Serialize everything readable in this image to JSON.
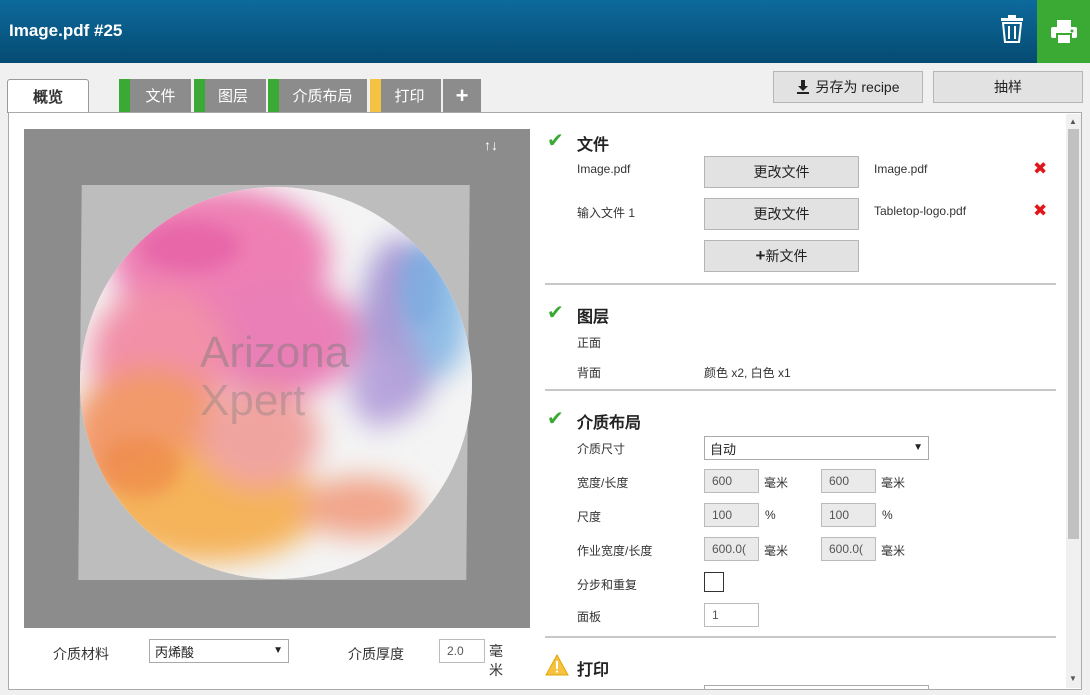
{
  "window": {
    "title": "Image.pdf #25"
  },
  "header": {
    "trash_icon": "trash-icon",
    "print_icon": "printer-icon",
    "print_color": "#3aaa35"
  },
  "tabs": [
    {
      "label": "概览",
      "active": true
    },
    {
      "label": "文件",
      "stripe": "#3aaa35"
    },
    {
      "label": "图层",
      "stripe": "#3aaa35"
    },
    {
      "label": "介质布局",
      "stripe": "#3aaa35"
    },
    {
      "label": "打印",
      "stripe": "#f5c242"
    },
    {
      "label": "+"
    }
  ],
  "toolbar": {
    "save_recipe": "另存为 recipe",
    "sample": "抽样"
  },
  "preview": {
    "watermark_line1": "Arizona",
    "watermark_line2": "Xpert",
    "arrows": "↑↓"
  },
  "bottom": {
    "media_material_label": "介质材料",
    "media_material_value": "丙烯酸",
    "media_thickness_label": "介质厚度",
    "media_thickness_value": "2.0",
    "media_thickness_unit": "毫\n米"
  },
  "sections": {
    "files": {
      "title": "文件",
      "rows": [
        {
          "label": "Image.pdf",
          "button": "更改文件",
          "filename": "Image.pdf"
        },
        {
          "label": "输入文件 1",
          "button": "更改文件",
          "filename": "Tabletop-logo.pdf"
        }
      ],
      "new_file": "新文件"
    },
    "layers": {
      "title": "图层",
      "front_label": "正面",
      "back_label": "背面",
      "back_value": "颜色 x2, 白色 x1"
    },
    "media_layout": {
      "title": "介质布局",
      "media_size_label": "介质尺寸",
      "media_size_value": "自动",
      "width_length_label": "宽度/长度",
      "width": "600",
      "length": "600",
      "unit_mm": "毫米",
      "scale_label": "尺度",
      "scale_x": "100",
      "scale_y": "100",
      "unit_pct": "%",
      "job_wl_label": "作业宽度/长度",
      "job_width": "600.0(",
      "job_length": "600.0(",
      "step_repeat_label": "分步和重复",
      "panel_label": "面板",
      "panel_value": "1"
    },
    "print": {
      "title": "打印"
    }
  }
}
